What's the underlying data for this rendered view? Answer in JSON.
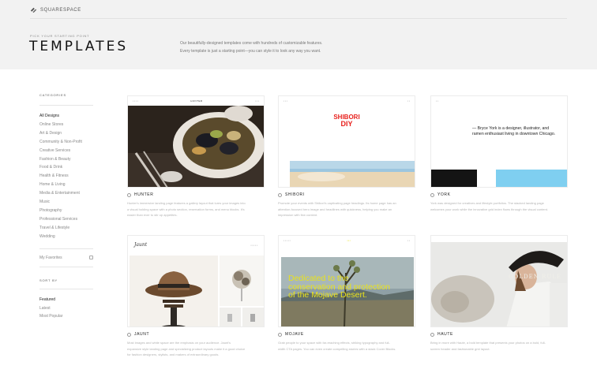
{
  "brand": {
    "name": "SQUARESPACE"
  },
  "hero": {
    "kicker": "PICK YOUR STARTING POINT",
    "title": "TEMPLATES",
    "description_line1": "Our beautifully-designed templates come with hundreds of customizable features.",
    "description_line2": "Every template is just a starting point—you can style it to look any way you want."
  },
  "sidebar": {
    "categories_heading": "CATEGORIES",
    "categories": [
      "All Designs",
      "Online Stores",
      "Art & Design",
      "Community & Non-Profit",
      "Creative Services",
      "Fashion & Beauty",
      "Food & Drink",
      "Health & Fitness",
      "Home & Living",
      "Media & Entertainment",
      "Music",
      "Photography",
      "Professional Services",
      "Travel & Lifestyle",
      "Wedding"
    ],
    "favorites_label": "My Favorites",
    "sort_heading": "SORT BY",
    "sort_options": [
      "Featured",
      "Latest",
      "Most Popular"
    ]
  },
  "templates": [
    {
      "name": "HUNTER",
      "description": "Hunter's immersive landing page features a gallery layout that lures your images into a visual holding space with a photo section, reservation forms, and menu blocks. It's easier than ever to stir up appetites."
    },
    {
      "name": "SHIBORI",
      "description": "Promote your events with Shibori's captivating page headings. Its home page has an attention-focused hero image and headlines with quickness, helping you make an impression with few content.",
      "hero_text_1": "SHIBORI",
      "hero_text_2": "DIY"
    },
    {
      "name": "YORK",
      "description": "York was designed for creatives and lifestyle portfolios. The stacked landing page welcomes your work while the innovative grid index flows through the visual content.",
      "hero_quote": "— Bryce York is a designer, illustrator, and ramen enthusiast living in downtown Chicago."
    },
    {
      "name": "JAUNT",
      "description": "Most images and white space are the emphasis on your audience. Jaunt's expansive style landing page and specializing product layouts make it a good choice for fashion designers, stylists, and makers of extraordinary goods.",
      "logo_text": "Jaunt"
    },
    {
      "name": "MOJAVE",
      "description": "Grab people to your space with far-reaching effects, striking typography and full-width CTA pages. You can even create compelling stories with a stack Cover Blocks.",
      "hero_text": "Dedicated to the conservation and protection of the Mojave Desert."
    },
    {
      "name": "HAUTE",
      "description": "Bring in more with Haute, a bold template that presents your photos on a bold, full-screen header and fashionable grid layout.",
      "hero_text": "GOLDEN RULE"
    }
  ],
  "colors": {
    "accent": "#111111",
    "hero_bg": "#f2f2f2",
    "shibori_red": "#e8211d",
    "york_blue": "#7fcff0",
    "mojave_yellow": "#e9e21c"
  }
}
